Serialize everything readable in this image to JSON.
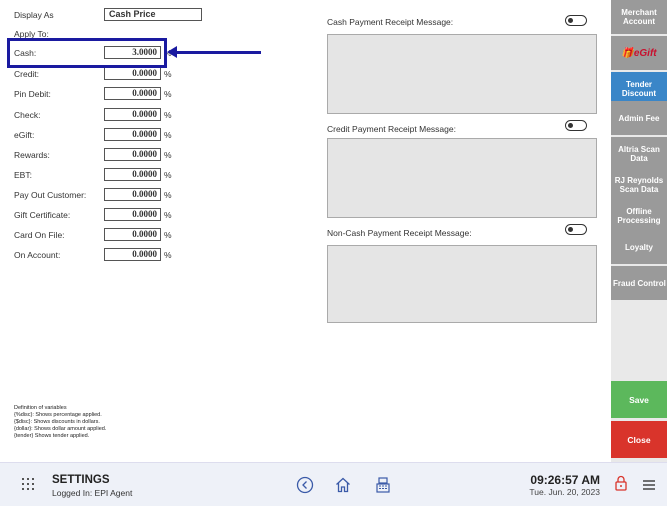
{
  "display_as": {
    "label": "Display As",
    "value": "Cash Price"
  },
  "apply_to_label": "Apply To:",
  "tenders": [
    {
      "label": "Cash:",
      "value": "3.0000",
      "unit": "%"
    },
    {
      "label": "Credit:",
      "value": "0.0000",
      "unit": "%"
    },
    {
      "label": "Pin Debit:",
      "value": "0.0000",
      "unit": "%"
    },
    {
      "label": "Check:",
      "value": "0.0000",
      "unit": "%"
    },
    {
      "label": "eGift:",
      "value": "0.0000",
      "unit": "%"
    },
    {
      "label": "Rewards:",
      "value": "0.0000",
      "unit": "%"
    },
    {
      "label": "EBT:",
      "value": "0.0000",
      "unit": "%"
    },
    {
      "label": "Pay Out Customer:",
      "value": "0.0000",
      "unit": "%"
    },
    {
      "label": "Gift Certificate:",
      "value": "0.0000",
      "unit": "%"
    },
    {
      "label": "Card On File:",
      "value": "0.0000",
      "unit": "%"
    },
    {
      "label": "On Account:",
      "value": "0.0000",
      "unit": "%"
    }
  ],
  "definitions": [
    "Definition of variables",
    "{%disc}: Shows percentage applied.",
    "{$disc}:  Shows discounts in dollars.",
    "{dollar}: Shows dollar amount applied.",
    "{tender} Shows tender applied."
  ],
  "messages": [
    {
      "label": "Cash Payment Receipt Message:",
      "value": ""
    },
    {
      "label": "Credit Payment Receipt Message:",
      "value": ""
    },
    {
      "label": "Non-Cash Payment Receipt Message:",
      "value": ""
    }
  ],
  "sidebar": [
    {
      "label": "Merchant Account",
      "active": false
    },
    {
      "label": "eGift",
      "active": false
    },
    {
      "label": "Tender Discount",
      "active": true
    },
    {
      "label": "Admin Fee",
      "active": false
    },
    {
      "label": "Altria Scan Data",
      "active": false
    },
    {
      "label": "RJ Reynolds Scan Data",
      "active": false
    },
    {
      "label": "Offline Processing",
      "active": false
    },
    {
      "label": "Loyalty",
      "active": false
    },
    {
      "label": "Fraud Control",
      "active": false
    }
  ],
  "actions": {
    "save": "Save",
    "close": "Close"
  },
  "footer": {
    "title": "SETTINGS",
    "logged_in": "Logged In:  EPI Agent",
    "time": "09:26:57 AM",
    "date": "Tue. Jun. 20, 2023"
  },
  "colors": {
    "accent": "#3a86c8",
    "save": "#5cb85c",
    "close": "#d9342b",
    "highlight": "#1a1aa0"
  }
}
